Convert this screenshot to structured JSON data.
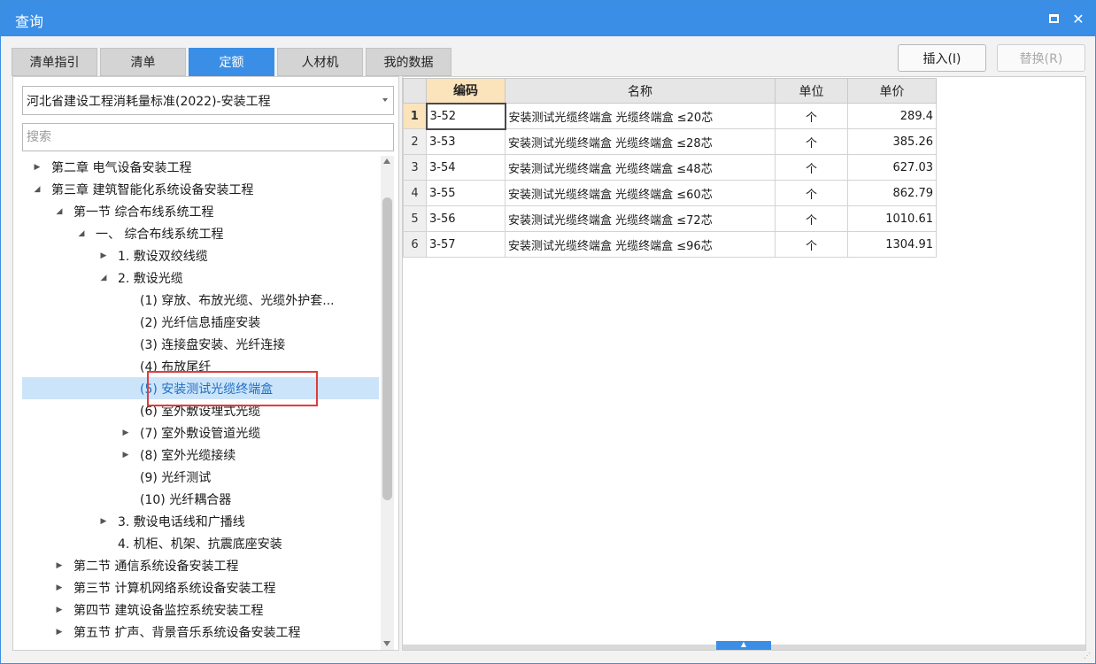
{
  "window": {
    "title": "查询"
  },
  "tabs": [
    {
      "label": "清单指引",
      "active": false
    },
    {
      "label": "清单",
      "active": false
    },
    {
      "label": "定额",
      "active": true
    },
    {
      "label": "人材机",
      "active": false
    },
    {
      "label": "我的数据",
      "active": false
    }
  ],
  "buttons": {
    "insert": "插入(I)",
    "replace": "替换(R)"
  },
  "library_select": {
    "value": "河北省建设工程消耗量标准(2022)-安装工程"
  },
  "search": {
    "placeholder": "搜索"
  },
  "tree": [
    {
      "label": "第二章 电气设备安装工程",
      "level": 1,
      "arrow": "collapsed"
    },
    {
      "label": "第三章 建筑智能化系统设备安装工程",
      "level": 1,
      "arrow": "expanded"
    },
    {
      "label": "第一节 综合布线系统工程",
      "level": 2,
      "arrow": "expanded"
    },
    {
      "label": "一、 综合布线系统工程",
      "level": 3,
      "arrow": "expanded"
    },
    {
      "label": "1. 敷设双绞线缆",
      "level": 4,
      "arrow": "collapsed"
    },
    {
      "label": "2. 敷设光缆",
      "level": 4,
      "arrow": "expanded"
    },
    {
      "label": "(1) 穿放、布放光缆、光缆外护套...",
      "level": 5,
      "arrow": "none"
    },
    {
      "label": "(2) 光纤信息插座安装",
      "level": 5,
      "arrow": "none"
    },
    {
      "label": "(3) 连接盘安装、光纤连接",
      "level": 5,
      "arrow": "none"
    },
    {
      "label": "(4) 布放尾纤",
      "level": 5,
      "arrow": "none"
    },
    {
      "label": "(5) 安装测试光缆终端盒",
      "level": 5,
      "arrow": "none",
      "selected": true
    },
    {
      "label": "(6) 室外敷设埋式光缆",
      "level": 5,
      "arrow": "none"
    },
    {
      "label": "(7) 室外敷设管道光缆",
      "level": 5,
      "arrow": "collapsed"
    },
    {
      "label": "(8) 室外光缆接续",
      "level": 5,
      "arrow": "collapsed"
    },
    {
      "label": "(9) 光纤测试",
      "level": 5,
      "arrow": "none"
    },
    {
      "label": "(10) 光纤耦合器",
      "level": 5,
      "arrow": "none"
    },
    {
      "label": "3. 敷设电话线和广播线",
      "level": 4,
      "arrow": "collapsed"
    },
    {
      "label": "4. 机柜、机架、抗震底座安装",
      "level": 4,
      "arrow": "none"
    },
    {
      "label": "第二节 通信系统设备安装工程",
      "level": 2,
      "arrow": "collapsed"
    },
    {
      "label": "第三节 计算机网络系统设备安装工程",
      "level": 2,
      "arrow": "collapsed"
    },
    {
      "label": "第四节 建筑设备监控系统安装工程",
      "level": 2,
      "arrow": "collapsed"
    },
    {
      "label": "第五节 扩声、背景音乐系统设备安装工程",
      "level": 2,
      "arrow": "collapsed"
    }
  ],
  "grid": {
    "columns": [
      "编码",
      "名称",
      "单位",
      "单价"
    ],
    "rows": [
      {
        "num": "1",
        "code": "3-52",
        "name": "安装测试光缆终端盒 光缆终端盒 ≤20芯",
        "unit": "个",
        "price": "289.4"
      },
      {
        "num": "2",
        "code": "3-53",
        "name": "安装测试光缆终端盒 光缆终端盒 ≤28芯",
        "unit": "个",
        "price": "385.26"
      },
      {
        "num": "3",
        "code": "3-54",
        "name": "安装测试光缆终端盒 光缆终端盒 ≤48芯",
        "unit": "个",
        "price": "627.03"
      },
      {
        "num": "4",
        "code": "3-55",
        "name": "安装测试光缆终端盒 光缆终端盒 ≤60芯",
        "unit": "个",
        "price": "862.79"
      },
      {
        "num": "5",
        "code": "3-56",
        "name": "安装测试光缆终端盒 光缆终端盒 ≤72芯",
        "unit": "个",
        "price": "1010.61"
      },
      {
        "num": "6",
        "code": "3-57",
        "name": "安装测试光缆终端盒 光缆终端盒 ≤96芯",
        "unit": "个",
        "price": "1304.91"
      }
    ]
  },
  "colors": {
    "accent": "#3a8ee6",
    "selection": "#cce4fa",
    "sort_header": "#fbe3bb",
    "highlight": "#e03c3c"
  }
}
